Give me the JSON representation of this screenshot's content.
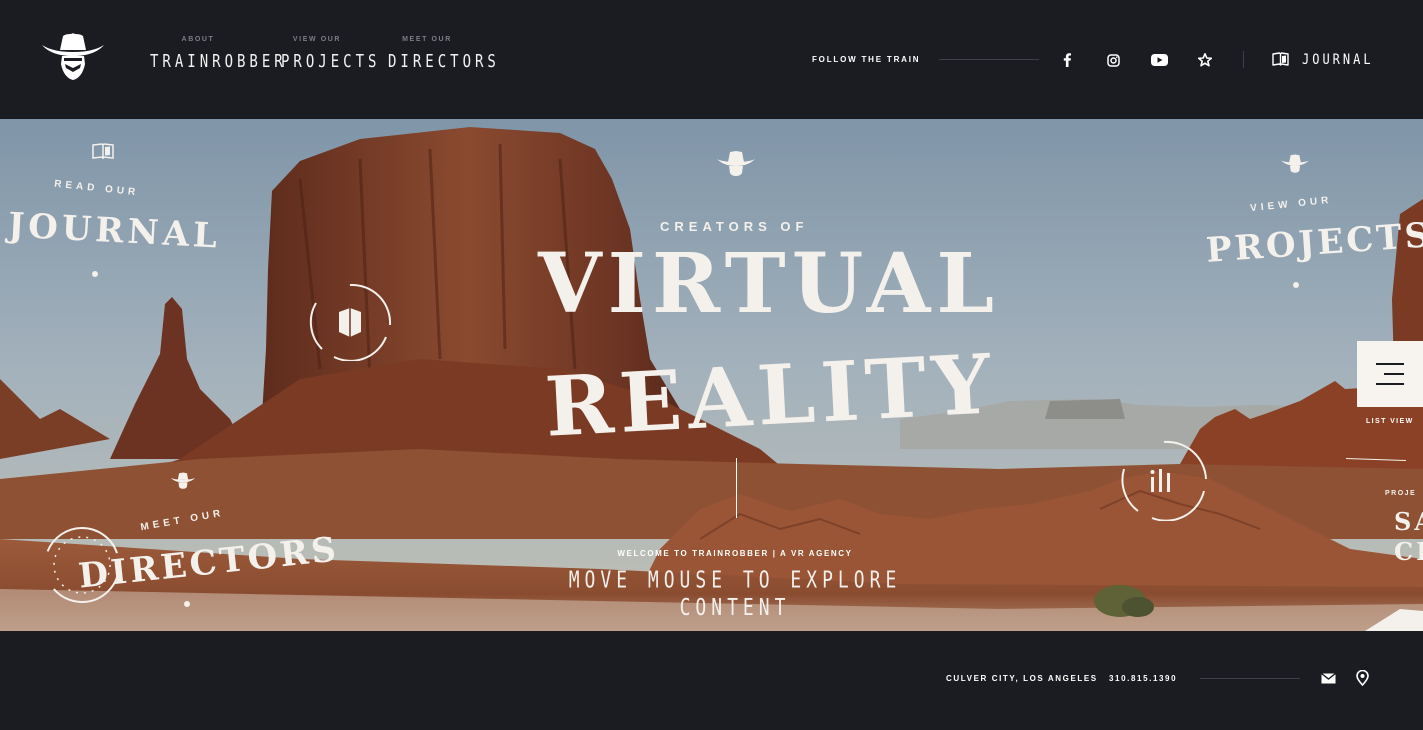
{
  "header": {
    "nav": [
      {
        "small": "ABOUT",
        "big": "TRAINROBBER"
      },
      {
        "small": "VIEW OUR",
        "big": "PROJECTS"
      },
      {
        "small": "MEET OUR",
        "big": "DIRECTORS"
      }
    ],
    "follow_label": "FOLLOW THE TRAIN",
    "social_icons": [
      "facebook-icon",
      "instagram-icon",
      "youtube-icon",
      "star-icon"
    ],
    "journal_label": "JOURNAL"
  },
  "hero": {
    "journal": {
      "small": "READ OUR",
      "big": "JOURNAL"
    },
    "projects": {
      "small": "VIEW OUR",
      "big": "PROJECTS"
    },
    "directors": {
      "small": "MEET OUR",
      "big": "DIRECTORS"
    },
    "creators": "CREATORS OF",
    "title_line1": "VIRTUAL",
    "title_line2": "REALITY",
    "welcome": "WELCOME TO TRAINROBBER | A VR AGENCY",
    "explore": "MOVE MOUSE TO EXPLORE CONTENT",
    "list_view": "LIST VIEW",
    "edge_small": "PROJE",
    "edge_big1": "SA",
    "edge_big2": "CH"
  },
  "footer": {
    "address": "CULVER CITY, LOS ANGELES",
    "phone": "310.815.1390"
  },
  "colors": {
    "background": "#1b1c21",
    "text": "#f4f0ec",
    "muted": "#7c7e86"
  }
}
